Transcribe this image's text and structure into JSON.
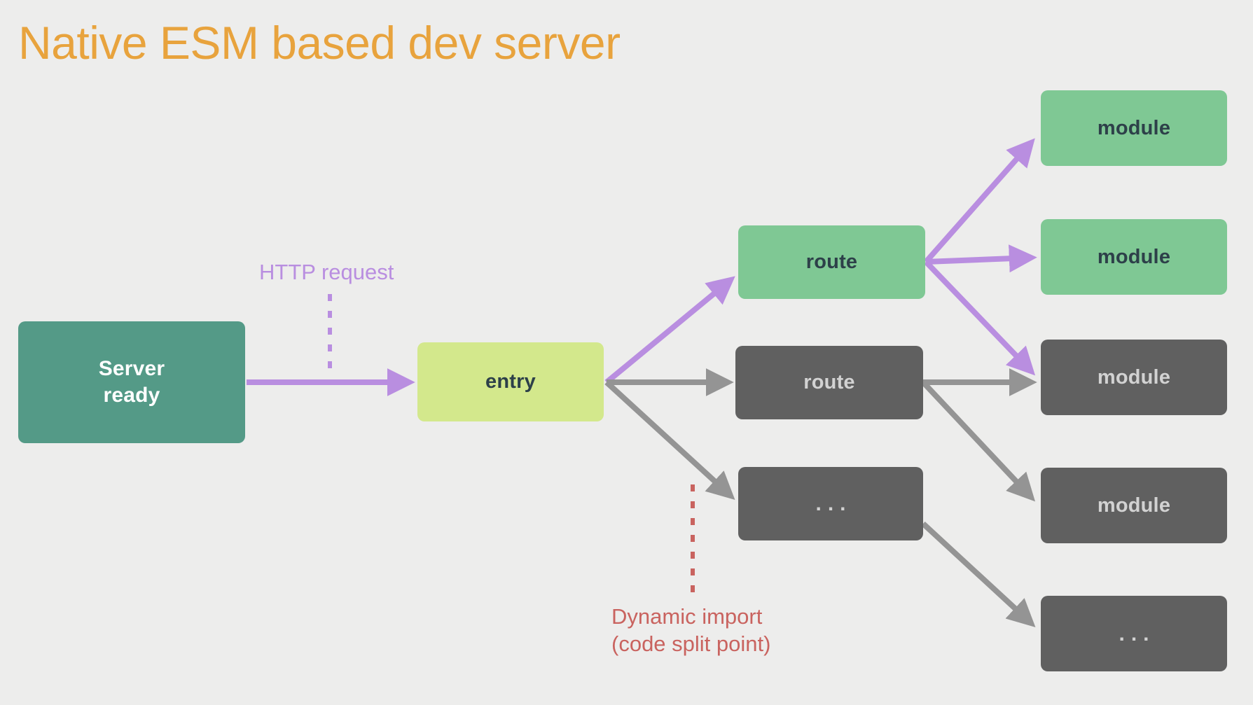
{
  "page": {
    "title": "Native ESM based dev server",
    "background_color": "#ededec",
    "title_color": "#e8a33d"
  },
  "colors": {
    "server_box": "#549a87",
    "entry_box": "#d3e88c",
    "active_box": "#7fc894",
    "inactive_box": "#606060",
    "active_arrow": "#b98ee0",
    "inactive_arrow": "#949494",
    "http_label": "#b98ee0",
    "dynamic_import_label": "#c9635f",
    "dark_text": "#2d4049",
    "light_text": "#d2d2d2"
  },
  "annotations": {
    "http_request": "HTTP request",
    "dynamic_import_line1": "Dynamic import",
    "dynamic_import_line2": "(code split point)"
  },
  "nodes": {
    "server": {
      "line1": "Server",
      "line2": "ready"
    },
    "entry": {
      "label": "entry"
    },
    "route_active": {
      "label": "route"
    },
    "route_inactive": {
      "label": "route"
    },
    "route_more": {
      "label": "..."
    },
    "module_1": {
      "label": "module"
    },
    "module_2": {
      "label": "module"
    },
    "module_3": {
      "label": "module"
    },
    "module_4": {
      "label": "module"
    },
    "module_more": {
      "label": "..."
    }
  },
  "chart_data": {
    "type": "diagram",
    "title": "Native ESM based dev server",
    "description": "Dependency graph showing a native ESM dev server resolving an HTTP request from the server entry through routes to leaf modules. Highlighted (green/purple) path is the on-demand requested path; grey nodes/edges are not requested.",
    "columns": [
      {
        "index": 0,
        "nodes": [
          "Server ready"
        ]
      },
      {
        "index": 1,
        "nodes": [
          "entry"
        ]
      },
      {
        "index": 2,
        "nodes": [
          "route",
          "route",
          "..."
        ]
      },
      {
        "index": 3,
        "nodes": [
          "module",
          "module",
          "module",
          "module",
          "..."
        ]
      }
    ],
    "node_states": {
      "Server ready": "server",
      "entry": "entry",
      "route (top)": "active",
      "route (middle)": "inactive",
      "... (routes)": "inactive",
      "module (1)": "active",
      "module (2)": "active",
      "module (3)": "inactive",
      "module (4)": "inactive",
      "... (modules)": "inactive"
    },
    "edges": [
      {
        "from": "Server ready",
        "to": "entry",
        "style": "active",
        "label": "HTTP request"
      },
      {
        "from": "entry",
        "to": "route (top)",
        "style": "active"
      },
      {
        "from": "entry",
        "to": "route (middle)",
        "style": "inactive"
      },
      {
        "from": "entry",
        "to": "... (routes)",
        "style": "inactive",
        "label": "Dynamic import (code split point)"
      },
      {
        "from": "route (top)",
        "to": "module (1)",
        "style": "active"
      },
      {
        "from": "route (top)",
        "to": "module (2)",
        "style": "active"
      },
      {
        "from": "route (top)",
        "to": "module (3)",
        "style": "active"
      },
      {
        "from": "route (middle)",
        "to": "module (3)",
        "style": "inactive"
      },
      {
        "from": "route (middle)",
        "to": "module (4)",
        "style": "inactive"
      },
      {
        "from": "... (routes)",
        "to": "... (modules)",
        "style": "inactive"
      }
    ]
  }
}
